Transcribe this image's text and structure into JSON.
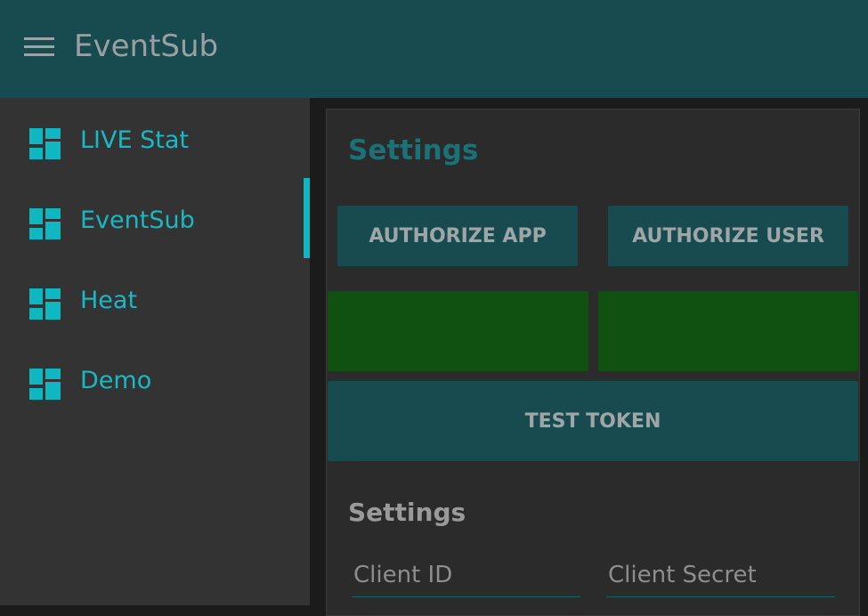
{
  "appbar": {
    "title": "EventSub",
    "menu_icon": "hamburger-icon"
  },
  "sidebar": {
    "items": [
      {
        "label": "LIVE Stat",
        "icon": "dashboard-icon"
      },
      {
        "label": "EventSub",
        "icon": "dashboard-icon",
        "selected": true
      },
      {
        "label": "Heat",
        "icon": "dashboard-icon"
      },
      {
        "label": "Demo",
        "icon": "dashboard-icon"
      }
    ]
  },
  "main": {
    "title": "Settings",
    "authorize_app": "AUTHORIZE APP",
    "authorize_user": "AUTHORIZE USER",
    "test_token": "TEST TOKEN",
    "settings_heading": "Settings",
    "client_id_label": "Client ID",
    "client_secret_label": "Client Secret"
  },
  "colors": {
    "accent": "#10b7c1",
    "appbar": "#174b4f",
    "status_ok": "#105010"
  }
}
